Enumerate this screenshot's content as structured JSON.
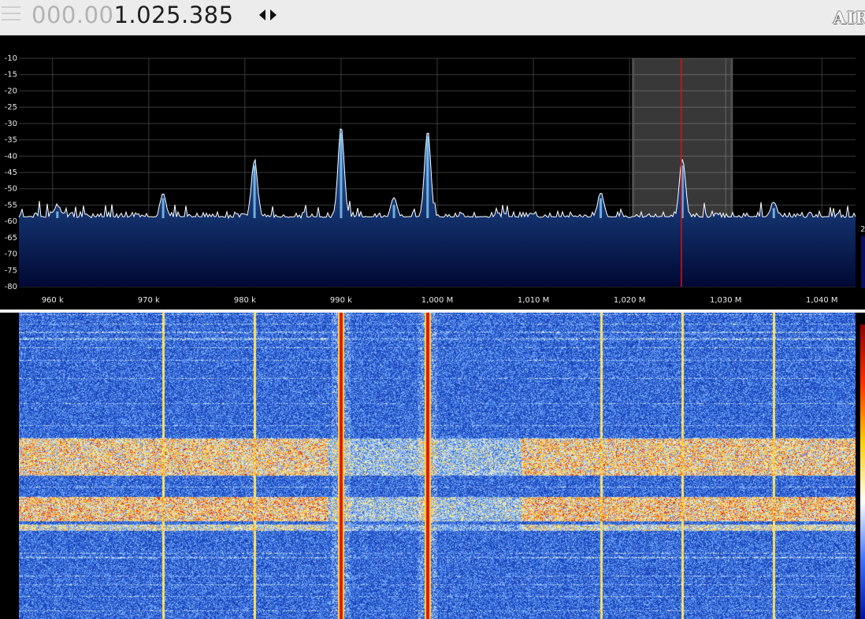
{
  "toolbar": {
    "frequency_dim": "000.00",
    "frequency_lit": "1.025.385",
    "brand": "AIR",
    "tune_arrows_icon": "left-right-arrows-icon"
  },
  "spectrum": {
    "db_ticks": [
      "-10",
      "-15",
      "-20",
      "-25",
      "-30",
      "-35",
      "-40",
      "-45",
      "-50",
      "-55",
      "-60",
      "-65",
      "-70",
      "-75",
      "-80"
    ],
    "freq_ticks": [
      "960 k",
      "970 k",
      "980 k",
      "990 k",
      "1,000 M",
      "1,010 M",
      "1,020 M",
      "1,030 M",
      "1,040 M"
    ],
    "side_label": "2",
    "y_range_db": [
      -80,
      -10
    ],
    "x_range_khz": [
      956.5,
      1043.5
    ],
    "tuned_khz": 1025.385,
    "passband_khz": [
      1020.5,
      1030.5
    ],
    "noise_floor_db": -59,
    "peaks": [
      {
        "khz": 981,
        "db": -41
      },
      {
        "khz": 990,
        "db": -31
      },
      {
        "khz": 999,
        "db": -32
      },
      {
        "khz": 1025.5,
        "db": -41
      },
      {
        "khz": 971.5,
        "db": -51
      },
      {
        "khz": 1017,
        "db": -51
      },
      {
        "khz": 995.5,
        "db": -53
      },
      {
        "khz": 1035,
        "db": -54
      },
      {
        "khz": 960.5,
        "db": -55
      }
    ],
    "colors": {
      "background": "#000000",
      "grid": "#3a3a3a",
      "trace": "#ffffff",
      "fill_top": "#2a63b0",
      "fill_bottom": "#000833",
      "tuned_line": "#e01010",
      "passband": "#ffffff"
    }
  },
  "waterfall": {
    "carriers_khz": [
      971.5,
      981,
      990,
      999,
      1017,
      1025.5,
      1035
    ],
    "strong_carriers_khz": [
      990,
      999
    ],
    "busy_bands": [
      {
        "from": 0.41,
        "to": 0.53,
        "level": 0.9
      },
      {
        "from": 0.6,
        "to": 0.68,
        "level": 0.95
      },
      {
        "from": 0.69,
        "to": 0.71,
        "level": 0.7
      }
    ],
    "colors": {
      "low": "#0a2a9a",
      "mid": "#5aa0ff",
      "high": "#ffe030",
      "peak": "#e02010"
    }
  }
}
